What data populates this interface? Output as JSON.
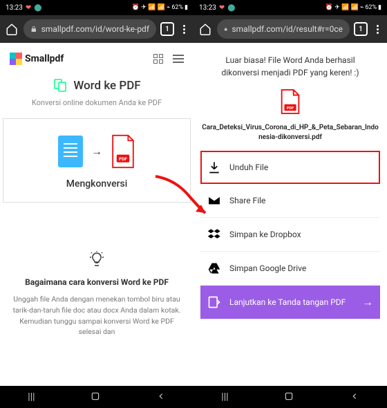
{
  "status": {
    "time": "13:23",
    "battery": "62%",
    "icons": "⏰ ✈ 📶 📶 ⌁"
  },
  "left": {
    "url": "smallpdf.com/id/word-ke-pdf",
    "tab_count": "1",
    "brand": "Smallpdf",
    "title": "Word ke PDF",
    "subtitle": "Konversi online dokumen Anda ke PDF",
    "converting": "Mengkonversi",
    "hint_title": "Bagaimana cara konversi Word ke PDF",
    "hint_text": "Unggah file Anda dengan menekan tombol biru atau tarik-dan-taruh file doc atau docx Anda dalam kotak. Kemudian tunggu sampai konversi Word ke PDF selesai dan"
  },
  "right": {
    "url": "smallpdf.com/id/result#r=0ce",
    "tab_count": "1",
    "success": "Luar biasa! File Word Anda berhasil dikonversi menjadi PDF yang keren! :)",
    "file_name": "Cara_Deteksi_Virus_Corona_di_HP_&_Peta_Sebaran_Indonesia-dikonversi.pdf",
    "actions": {
      "download": "Unduh File",
      "share": "Share File",
      "dropbox": "Simpan ke Dropbox",
      "gdrive": "Simpan Google Drive",
      "sign": "Lanjutkan ke Tanda tangan PDF"
    }
  }
}
